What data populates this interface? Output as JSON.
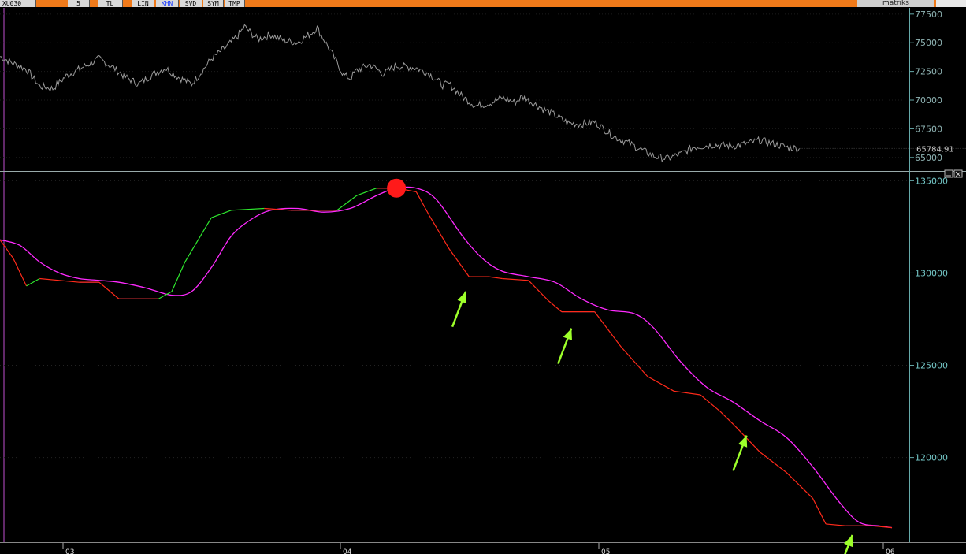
{
  "toolbar": {
    "symbol": "XU030",
    "interval": "5",
    "buttons": [
      "TL",
      "LIN",
      "KHN",
      "SVD",
      "SYM",
      "TMP"
    ],
    "active_button": "KHN",
    "brand": "matriks"
  },
  "colors": {
    "toolbar_bg": "#f07a1a",
    "price_line": "#9a9a9a",
    "fast_up": "#2ee82e",
    "fast_down": "#ff2a1a",
    "slow_line": "#ff2aff",
    "flat_line": "#8a7cff",
    "marker": "#ff1a1a",
    "arrow": "#9dff2a",
    "axis": "#7fb8b8"
  },
  "chart_data": [
    {
      "type": "line",
      "title": "",
      "ylabel": "",
      "ylim": [
        64300,
        77900
      ],
      "y_ticks": [
        "77500",
        "75000",
        "72500",
        "70000",
        "67500",
        "65000"
      ],
      "last_value": "65784.91",
      "series": [
        {
          "color": "#9a9a9a",
          "points": [
            [
              0,
              73800
            ],
            [
              4,
              73200
            ],
            [
              8,
              72700
            ],
            [
              12,
              71200
            ],
            [
              16,
              71000
            ],
            [
              20,
              72100
            ],
            [
              26,
              73000
            ],
            [
              30,
              73600
            ],
            [
              34,
              72900
            ],
            [
              38,
              72000
            ],
            [
              42,
              71400
            ],
            [
              46,
              72200
            ],
            [
              50,
              72800
            ],
            [
              54,
              72000
            ],
            [
              58,
              71400
            ],
            [
              60,
              72100
            ],
            [
              64,
              73600
            ],
            [
              68,
              74500
            ],
            [
              72,
              75600
            ],
            [
              74,
              76400
            ],
            [
              78,
              75300
            ],
            [
              82,
              75700
            ],
            [
              86,
              75200
            ],
            [
              90,
              75000
            ],
            [
              94,
              75800
            ],
            [
              96,
              76300
            ],
            [
              100,
              74300
            ],
            [
              104,
              72200
            ],
            [
              106,
              71900
            ],
            [
              108,
              72600
            ],
            [
              112,
              73100
            ],
            [
              116,
              72300
            ],
            [
              120,
              73000
            ],
            [
              126,
              72800
            ],
            [
              130,
              72300
            ],
            [
              134,
              71300
            ],
            [
              136,
              71400
            ],
            [
              140,
              70300
            ],
            [
              144,
              69500
            ],
            [
              148,
              69700
            ],
            [
              152,
              70200
            ],
            [
              156,
              69800
            ],
            [
              158,
              70300
            ],
            [
              164,
              69300
            ],
            [
              168,
              68700
            ],
            [
              172,
              68000
            ],
            [
              176,
              67900
            ],
            [
              180,
              68100
            ],
            [
              186,
              66800
            ],
            [
              190,
              66300
            ],
            [
              194,
              65700
            ],
            [
              198,
              65100
            ],
            [
              202,
              64900
            ],
            [
              206,
              65300
            ],
            [
              210,
              65900
            ],
            [
              216,
              66100
            ],
            [
              222,
              66000
            ],
            [
              226,
              66200
            ],
            [
              230,
              66500
            ],
            [
              234,
              66200
            ],
            [
              238,
              65900
            ],
            [
              242,
              65785
            ]
          ]
        }
      ]
    },
    {
      "type": "line",
      "title": "",
      "ylabel": "",
      "ylim": [
        115500,
        135400
      ],
      "y_ticks": [
        "135000",
        "130000",
        "125000",
        "120000"
      ],
      "date_labels": [
        "03",
        "04",
        "05",
        "06"
      ],
      "series": [
        {
          "color": "#ff2aff",
          "points": [
            [
              0,
              131800
            ],
            [
              6,
              131500
            ],
            [
              12,
              130600
            ],
            [
              18,
              130000
            ],
            [
              24,
              129700
            ],
            [
              30,
              129600
            ],
            [
              36,
              129500
            ],
            [
              44,
              129200
            ],
            [
              52,
              128800
            ],
            [
              58,
              129000
            ],
            [
              64,
              130300
            ],
            [
              70,
              132000
            ],
            [
              76,
              132900
            ],
            [
              82,
              133400
            ],
            [
              90,
              133500
            ],
            [
              98,
              133300
            ],
            [
              106,
              133500
            ],
            [
              114,
              134200
            ],
            [
              120,
              134600
            ],
            [
              126,
              134600
            ],
            [
              132,
              134000
            ],
            [
              140,
              132000
            ],
            [
              146,
              130800
            ],
            [
              152,
              130100
            ],
            [
              160,
              129800
            ],
            [
              168,
              129500
            ],
            [
              176,
              128600
            ],
            [
              184,
              128000
            ],
            [
              192,
              127800
            ],
            [
              198,
              127000
            ],
            [
              206,
              125200
            ],
            [
              214,
              123800
            ],
            [
              222,
              123000
            ],
            [
              230,
              122000
            ],
            [
              238,
              121100
            ],
            [
              246,
              119500
            ],
            [
              254,
              117600
            ],
            [
              260,
              116500
            ],
            [
              266,
              116300
            ],
            [
              270,
              116200
            ]
          ]
        },
        {
          "color": "#ff2a1a",
          "points": [
            [
              0,
              131800
            ],
            [
              4,
              130800
            ],
            [
              8,
              129300
            ],
            [
              12,
              129700
            ],
            [
              18,
              129600
            ],
            [
              24,
              129500
            ],
            [
              30,
              129500
            ],
            [
              36,
              128600
            ],
            [
              42,
              128600
            ],
            [
              48,
              128600
            ],
            [
              52,
              129000
            ],
            [
              56,
              130600
            ],
            [
              60,
              131800
            ],
            [
              64,
              133000
            ],
            [
              70,
              133400
            ],
            [
              80,
              133500
            ],
            [
              88,
              133400
            ],
            [
              96,
              133400
            ],
            [
              102,
              133400
            ],
            [
              108,
              134200
            ],
            [
              114,
              134600
            ],
            [
              120,
              134600
            ],
            [
              126,
              134400
            ],
            [
              130,
              133100
            ],
            [
              136,
              131300
            ],
            [
              142,
              129800
            ],
            [
              148,
              129800
            ],
            [
              152,
              129700
            ],
            [
              160,
              129600
            ],
            [
              166,
              128500
            ],
            [
              170,
              127900
            ],
            [
              176,
              127900
            ],
            [
              180,
              127900
            ],
            [
              188,
              126000
            ],
            [
              196,
              124400
            ],
            [
              204,
              123600
            ],
            [
              212,
              123400
            ],
            [
              218,
              122500
            ],
            [
              222,
              121800
            ],
            [
              230,
              120300
            ],
            [
              238,
              119200
            ],
            [
              246,
              117800
            ],
            [
              250,
              116400
            ],
            [
              256,
              116300
            ],
            [
              264,
              116300
            ],
            [
              270,
              116200
            ]
          ],
          "note_segments_green": [
            [
              56,
              64
            ],
            [
              104,
              108
            ]
          ]
        }
      ],
      "markers": [
        {
          "kind": "circle",
          "x": 120,
          "y": 134600,
          "color": "#ff1a1a"
        }
      ],
      "arrows": [
        {
          "x": 141,
          "y": 129000
        },
        {
          "x": 173,
          "y": 127000
        },
        {
          "x": 226,
          "y": 121200
        },
        {
          "x": 258,
          "y": 115800
        }
      ]
    }
  ]
}
